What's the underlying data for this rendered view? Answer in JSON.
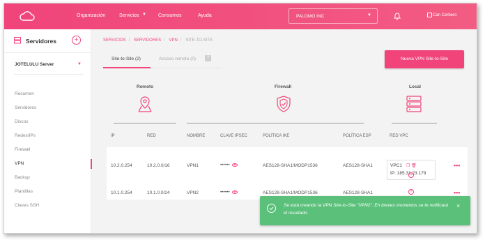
{
  "colors": {
    "accent": "#f0447a",
    "success": "#5bc07a",
    "background": "#f3f3f3"
  },
  "topbar": {
    "logo_icon": "cloud-icon",
    "nav": [
      {
        "label": "Organización"
      },
      {
        "label": "Servicios"
      },
      {
        "label": "Consumos"
      },
      {
        "label": "Ayuda"
      }
    ],
    "org_select": {
      "value": "PALOMO INC"
    },
    "bell_icon": "bell-icon",
    "avatar_alt": "Can Cerbero"
  },
  "sidebar": {
    "title": "Servidores",
    "add_icon": "plus-icon",
    "server_select": "JOTELULU Server",
    "items": [
      {
        "label": "Resumen",
        "active": false
      },
      {
        "label": "Servidores",
        "active": false
      },
      {
        "label": "Discos",
        "active": false
      },
      {
        "label": "Redes/IPs",
        "active": false
      },
      {
        "label": "Firewall",
        "active": false
      },
      {
        "label": "VPN",
        "active": true
      },
      {
        "label": "Backup",
        "active": false
      },
      {
        "label": "Plantillas",
        "active": false
      },
      {
        "label": "Claves SSH",
        "active": false
      }
    ]
  },
  "breadcrumb": {
    "items": [
      "SERVICIOS",
      "SERVIDORES",
      "VPN",
      "SITE-TO-SITE"
    ]
  },
  "tabs": [
    {
      "label": "Site-to-Site (2)",
      "active": true
    },
    {
      "label": "Acceso remoto (0)",
      "active": false
    }
  ],
  "tab_help": "?",
  "new_button": "Nueva VPN Site-to-Site",
  "diagram": {
    "remote": "Remoto",
    "firewall": "Firewall",
    "local": "Local"
  },
  "table": {
    "headers": [
      "IP",
      "RED",
      "NOMBRE",
      "CLAVE IPSEC",
      "POLÍTICA IKE",
      "POLÍTICA ESP",
      "RED VPC"
    ],
    "rows": [
      {
        "ip": "10.2.0.254",
        "red": "10.2.0.0/16",
        "nombre": "VPN1",
        "clave": "••••••",
        "ike": "AES128-SHA1/MODP1536",
        "esp": "AES128-SHA1",
        "vpc_name": "VPC1",
        "vpc_ip": "IP: 185.31.23.179"
      },
      {
        "ip": "10.1.0.254",
        "red": "10.1.0.0/24",
        "nombre": "VPN2",
        "clave": "••••••",
        "ike": "AES128-SHA1/MODP1536",
        "esp": "AES128-SHA1"
      }
    ],
    "more_label": "•••"
  },
  "toast": {
    "message": "Se está creando la VPN Site-to-Site \"VPN2\". En breves momentos se te notificará el resultado.",
    "close": "×"
  }
}
